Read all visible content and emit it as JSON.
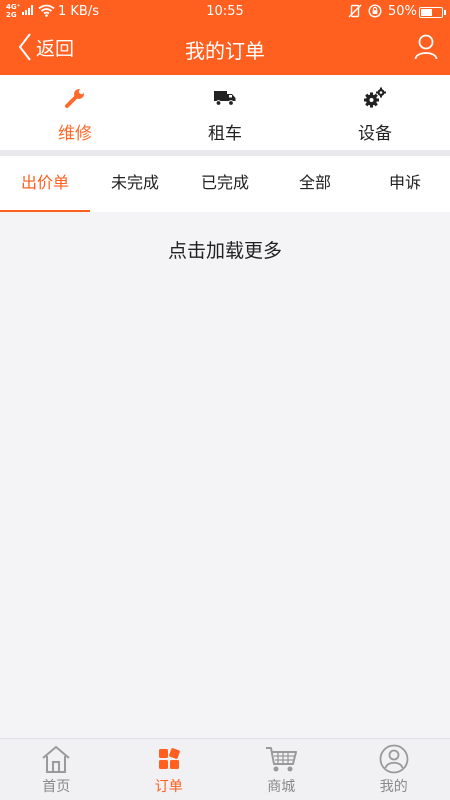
{
  "status_bar": {
    "network": "4G⁺\n2G",
    "speed": "1 KB/s",
    "time": "10:55",
    "battery_percent": "50%",
    "battery_level": 0.5
  },
  "header": {
    "back_label": "返回",
    "title": "我的订单",
    "user_icon": "user-icon"
  },
  "categories": [
    {
      "label": "维修",
      "icon": "wrench-icon",
      "active": true
    },
    {
      "label": "租车",
      "icon": "truck-icon",
      "active": false
    },
    {
      "label": "设备",
      "icon": "gears-icon",
      "active": false
    }
  ],
  "tabs": [
    {
      "label": "出价单",
      "active": true
    },
    {
      "label": "未完成",
      "active": false
    },
    {
      "label": "已完成",
      "active": false
    },
    {
      "label": "全部",
      "active": false
    },
    {
      "label": "申诉",
      "active": false
    }
  ],
  "load_more": "点击加载更多",
  "bottom_nav": [
    {
      "label": "首页",
      "icon": "home-icon",
      "active": false
    },
    {
      "label": "订单",
      "icon": "orders-icon",
      "active": true
    },
    {
      "label": "商城",
      "icon": "cart-icon",
      "active": false
    },
    {
      "label": "我的",
      "icon": "profile-icon",
      "active": false
    }
  ],
  "colors": {
    "accent": "#ff5f1f",
    "active_text": "#ff6a2a",
    "inactive_icon": "#9a9a9a",
    "background": "#f4f3f6"
  }
}
